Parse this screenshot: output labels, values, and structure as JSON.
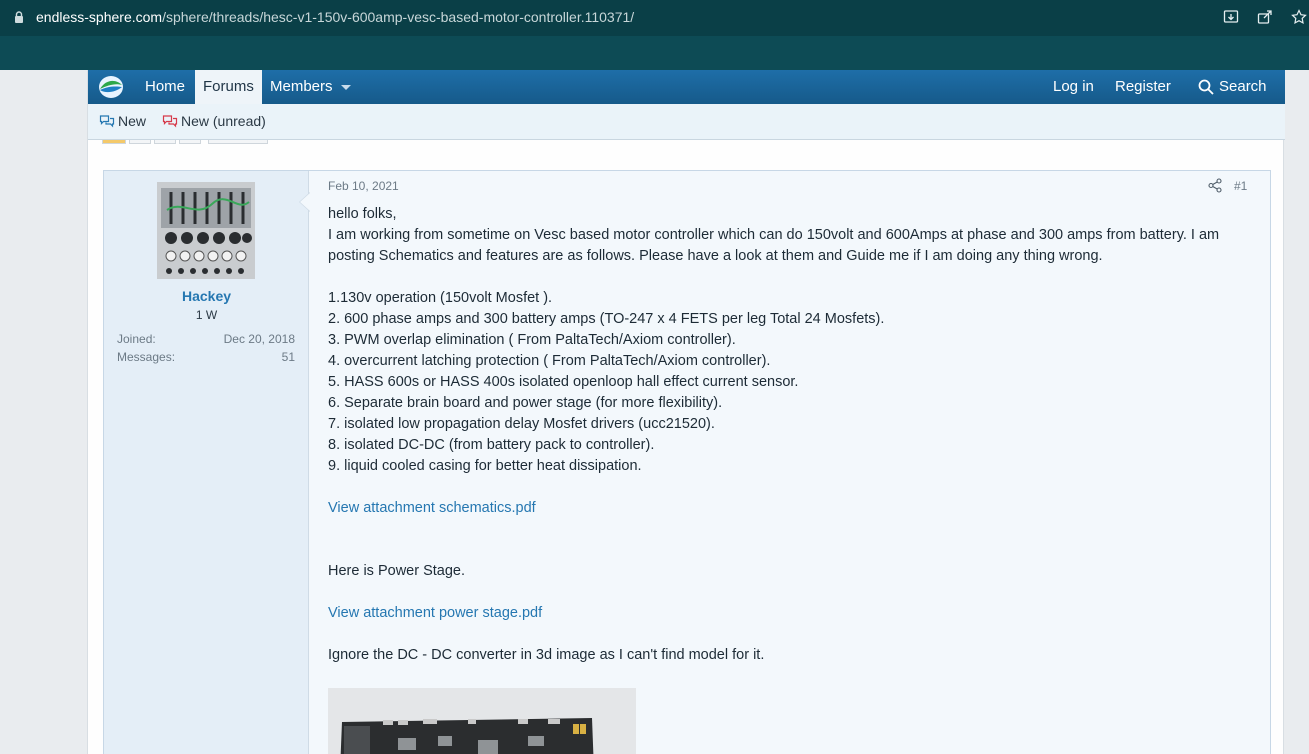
{
  "browser": {
    "url_host": "endless-sphere.com",
    "url_path": "/sphere/threads/hesc-v1-150v-600amp-vesc-based-motor-controller.110371/"
  },
  "nav": {
    "home": "Home",
    "forums": "Forums",
    "members": "Members",
    "login": "Log in",
    "register": "Register",
    "search": "Search"
  },
  "subnav": {
    "new": "New",
    "new_unread": "New (unread)"
  },
  "post": {
    "date": "Feb 10, 2021",
    "number": "#1",
    "user": {
      "name": "Hackey",
      "title": "1 W",
      "joined_label": "Joined:",
      "joined_value": "Dec 20, 2018",
      "messages_label": "Messages:",
      "messages_value": "51"
    },
    "lines": [
      "hello folks,",
      "I am working from sometime on Vesc based motor controller which can do 150volt and 600Amps at phase and 300 amps from battery. I am",
      "posting Schematics and features are as follows. Please have a look at them and Guide me if I am doing any thing wrong.",
      "1.130v operation (150volt Mosfet ).",
      "2. 600 phase amps and 300 battery amps (TO-247 x 4 FETS per leg Total 24 Mosfets).",
      "3. PWM overlap elimination ( From PaltaTech/Axiom controller).",
      "4. overcurrent latching protection ( From PaltaTech/Axiom controller).",
      "5. HASS 600s or HASS 400s isolated openloop hall effect current sensor.",
      "6. Separate brain board and power stage (for more flexibility).",
      "7. isolated low propagation delay Mosfet drivers (ucc21520).",
      "8. isolated DC-DC (from battery pack to controller).",
      "9. liquid cooled casing for better heat dissipation.",
      "Here is Power Stage.",
      "Ignore the DC - DC converter in 3d image as I can't find model for it."
    ],
    "link_schematics": "View attachment schematics.pdf",
    "link_power_stage": "View attachment power stage.pdf"
  },
  "colors": {
    "nav_blue": "#185886",
    "link_blue": "#2577b1",
    "browser_teal": "#0d4b55"
  }
}
